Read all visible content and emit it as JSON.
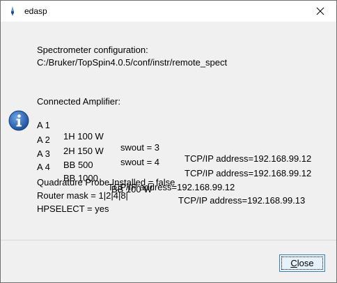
{
  "window": {
    "title": "edasp",
    "app_icon": "topspin-app-icon",
    "close_icon": "close-icon"
  },
  "message": {
    "icon": "info-icon",
    "config_heading": "Spectrometer configuration:",
    "config_path": "C:/Bruker/TopSpin4.0.5/conf/instr/remote_spect",
    "amplifier_heading": "Connected Amplifier:",
    "amplifiers": [
      {
        "id": "A 1",
        "desc": "1H 100 W",
        "extra": "swout = 3",
        "address": "TCP/IP address=192.168.99.12"
      },
      {
        "id": "A 2",
        "desc": "2H 150 W",
        "extra": "swout = 4",
        "address": "TCP/IP address=192.168.99.12"
      },
      {
        "id": "A 3",
        "desc": "BB 500",
        "extra": "",
        "address": "TCP/IP address=192.168.99.12"
      },
      {
        "id": "A 4",
        "desc": "BB 1000",
        "extra": "BB 100 W",
        "address": "TCP/IP address=192.168.99.13"
      }
    ],
    "quadrature": "Quadrature Probe Installed = false",
    "router_mask": "Router mask = 1|2|4|8|",
    "hpselect": "HPSELECT = yes"
  },
  "footer": {
    "close_label_first": "C",
    "close_label_rest": "lose"
  }
}
